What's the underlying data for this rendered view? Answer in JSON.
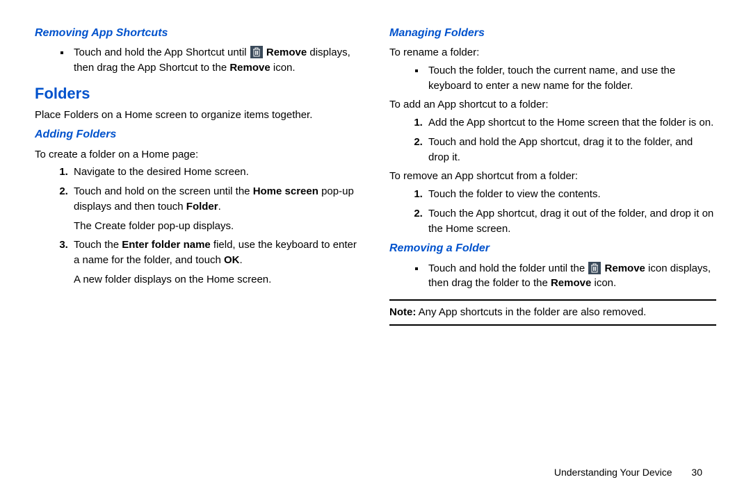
{
  "left": {
    "sub1_title": "Removing App Shortcuts",
    "sub1_item_pre": "Touch and hold the App Shortcut until ",
    "sub1_item_remove": "Remove",
    "sub1_item_mid": " displays, then drag the App Shortcut to the ",
    "sub1_item_removeicon": "Remove",
    "sub1_item_post": " icon.",
    "section_title": "Folders",
    "section_intro": "Place Folders on a Home screen to organize items together.",
    "sub2_title": "Adding Folders",
    "sub2_intro": "To create a folder on a Home page:",
    "sub2_li1": "Navigate to the desired Home screen.",
    "sub2_li2_pre": "Touch and hold on the screen until the ",
    "sub2_li2_bold": "Home screen",
    "sub2_li2_mid": " pop-up displays and then touch ",
    "sub2_li2_bold2": "Folder",
    "sub2_li2_post": ".",
    "sub2_li2_follow": "The Create folder pop-up displays.",
    "sub2_li3_pre": "Touch the ",
    "sub2_li3_bold": "Enter folder name",
    "sub2_li3_mid": " field, use the keyboard to enter a name for the folder, and touch ",
    "sub2_li3_bold2": "OK",
    "sub2_li3_post": ".",
    "sub2_li3_follow": "A new folder displays on the Home screen."
  },
  "right": {
    "sub1_title": "Managing Folders",
    "rename_intro": "To rename a folder:",
    "rename_item": "Touch the folder, touch the current name, and use the keyboard to enter a new name for the folder.",
    "add_intro": "To add an App shortcut to a folder:",
    "add_li1": "Add the App shortcut to the Home screen that the folder is on.",
    "add_li2": "Touch and hold the App shortcut, drag it to the folder, and drop it.",
    "remove_intro": "To remove an App shortcut from a folder:",
    "remove_li1": "Touch the folder to view the contents.",
    "remove_li2": "Touch the App shortcut, drag it out of the folder, and drop it on the Home screen.",
    "sub2_title": "Removing a Folder",
    "sub2_item_pre": "Touch and hold the folder until the ",
    "sub2_item_remove": "Remove",
    "sub2_item_mid": " icon displays, then drag the folder to the ",
    "sub2_item_remove2": "Remove",
    "sub2_item_post": " icon.",
    "note_label": "Note:",
    "note_text": " Any App shortcuts in the folder are also removed."
  },
  "footer": {
    "section": "Understanding Your Device",
    "page": "30"
  }
}
